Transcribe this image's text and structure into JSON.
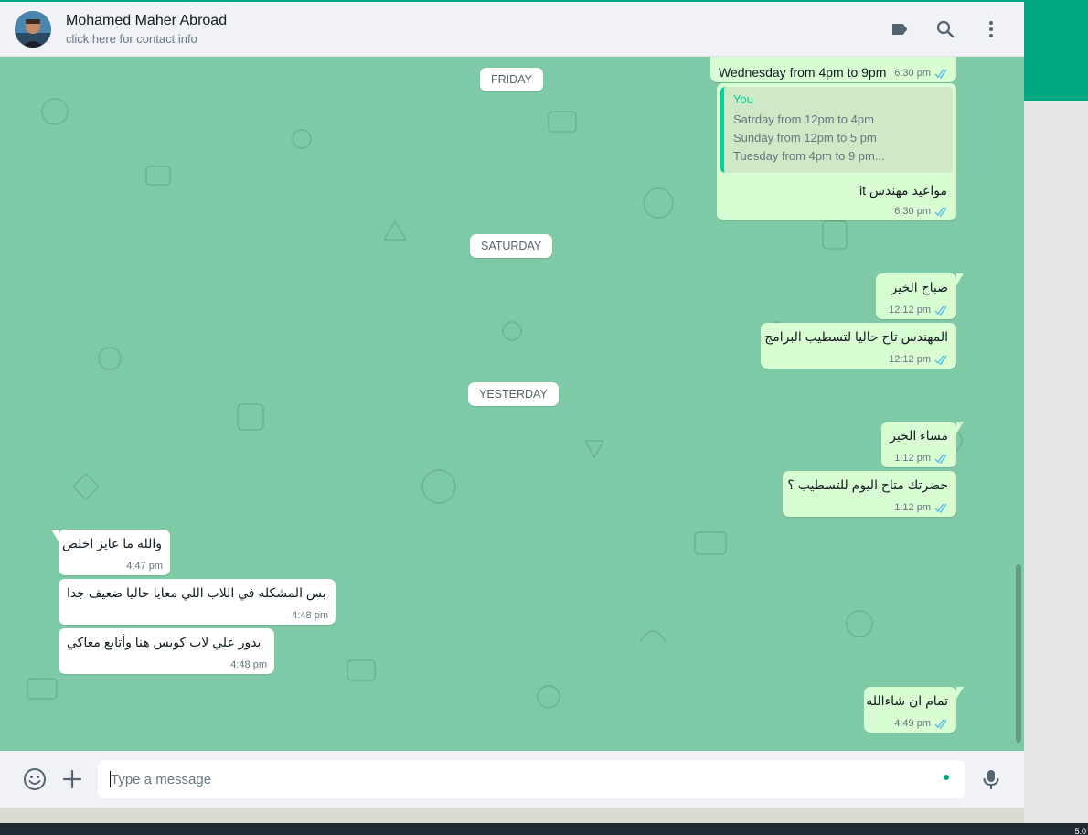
{
  "header": {
    "contact_name": "Mohamed Maher Abroad",
    "contact_sub": "click here for contact info",
    "icons": [
      "label-icon",
      "search-icon",
      "menu-icon"
    ]
  },
  "dates": {
    "friday": "FRIDAY",
    "saturday": "SATURDAY",
    "yesterday": "YESTERDAY"
  },
  "messages": {
    "m1": {
      "text": "Wednesday from 4pm to 9pm",
      "time": "6:30 pm"
    },
    "m2": {
      "quote_author": "You",
      "quote_lines": [
        "Satrday from 12pm to 4pm",
        "Sunday from 12pm to 5 pm",
        "Tuesday from 4pm to 9 pm..."
      ],
      "text": "مواعيد مهندس it",
      "time": "6:30 pm"
    },
    "m3": {
      "text": "صباح الخير",
      "time": "12:12 pm"
    },
    "m4": {
      "text": "المهندس تاح حاليا لتسطيب البرامج",
      "time": "12:12 pm"
    },
    "m5": {
      "text": "مساء الخير",
      "time": "1:12 pm"
    },
    "m6": {
      "text": "حضرتك متاح اليوم للتسطيب ؟",
      "time": "1:12 pm"
    },
    "m7": {
      "text": "والله ما عايز اخلص",
      "time": "4:47 pm"
    },
    "m8": {
      "text": "بس المشكله في اللاب اللي معايا حاليا ضعيف جدا",
      "time": "4:48 pm"
    },
    "m9": {
      "text": "بدور علي لاب كويس هنا وأتابع معاكي",
      "time": "4:48 pm"
    },
    "m10": {
      "text": "تمام ان شاءالله",
      "time": "4:49 pm"
    }
  },
  "composer": {
    "placeholder": "Type a message",
    "value": ""
  },
  "taskbar": {
    "time": "5:0"
  },
  "colors": {
    "accent": "#00a884",
    "outgoing": "#d9fdd3",
    "incoming": "#ffffff",
    "wallpaper": "#7fcaa6",
    "tick": "#53bdeb"
  }
}
